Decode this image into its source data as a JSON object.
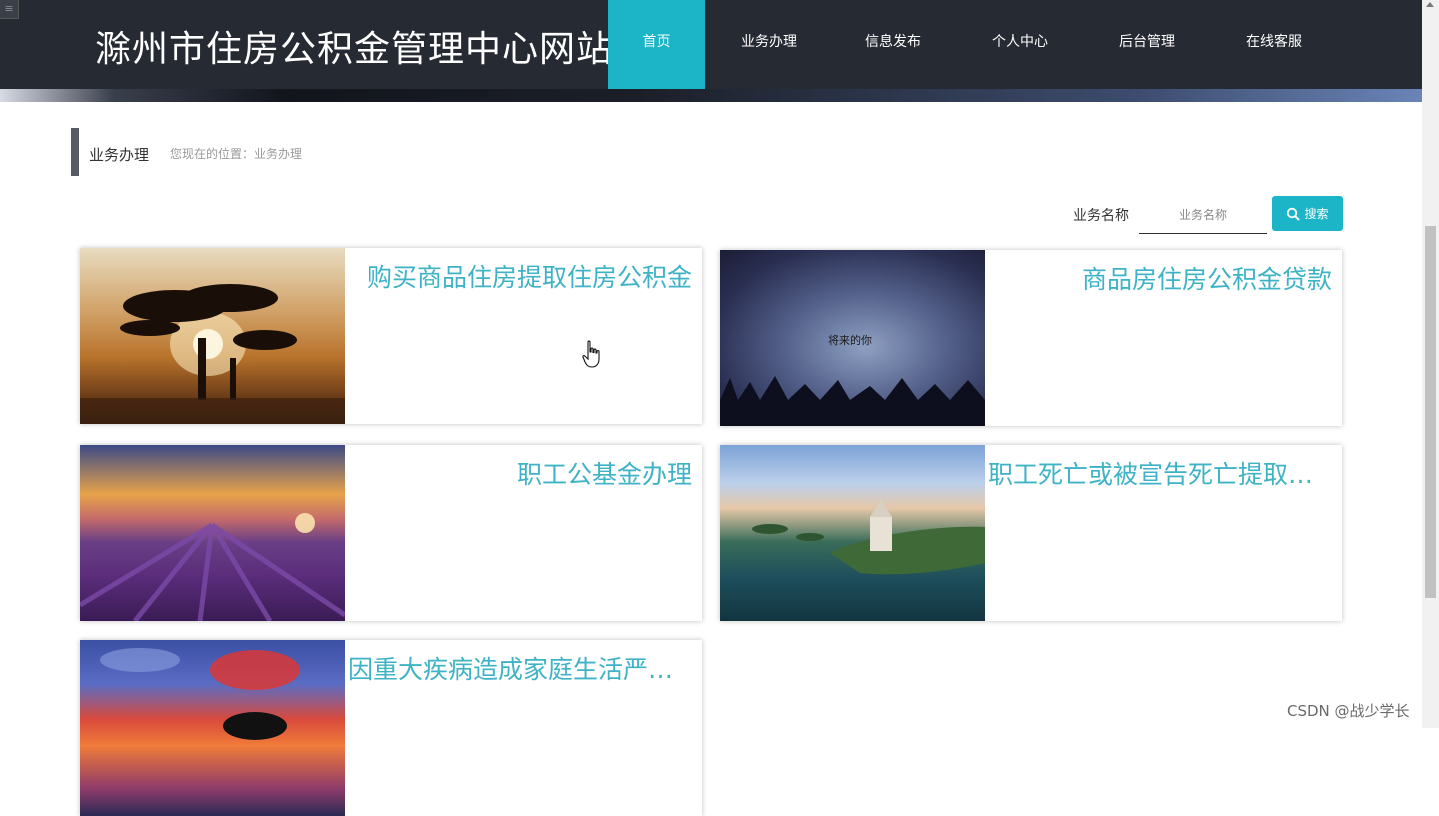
{
  "header": {
    "site_title": "滁州市住房公积金管理中心网站",
    "nav": [
      {
        "label": "首页",
        "active": true
      },
      {
        "label": "业务办理",
        "active": false
      },
      {
        "label": "信息发布",
        "active": false
      },
      {
        "label": "个人中心",
        "active": false
      },
      {
        "label": "后台管理",
        "active": false
      },
      {
        "label": "在线客服",
        "active": false
      }
    ]
  },
  "breadcrumb": {
    "title": "业务办理",
    "path": "您现在的位置：业务办理"
  },
  "search": {
    "label": "业务名称",
    "placeholder": "业务名称",
    "button_label": "搜索"
  },
  "cards": [
    {
      "title": "购买商品住房提取住房公积金",
      "image": "tree-sunset-image"
    },
    {
      "title": "商品房住房公积金贷款",
      "image": "night-sky-image"
    },
    {
      "title": "职工公基金办理",
      "image": "lavender-field-image"
    },
    {
      "title": "职工死亡或被宣告死亡提取住房公积金",
      "image": "lake-castle-image"
    },
    {
      "title": "因重大疾病造成家庭生活严重困难提取住房公积金",
      "image": "sunset-sky-image"
    }
  ],
  "overlay_text": {
    "night_image_caption": "将来的你"
  },
  "watermark": "CSDN @战少学长",
  "colors": {
    "header_bg": "#262a33",
    "accent": "#1cb5c7",
    "card_title": "#3fb3c6"
  }
}
